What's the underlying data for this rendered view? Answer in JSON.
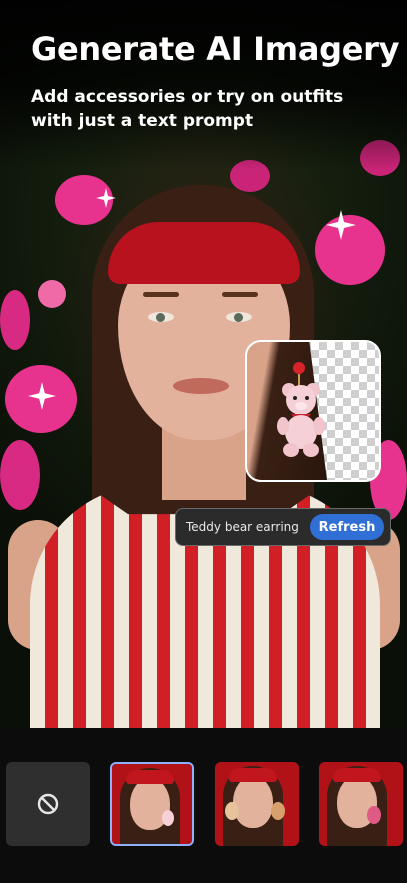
{
  "header": {
    "title": "Generate AI Imagery",
    "subtitle": "Add accessories or try on outfits with just a text prompt"
  },
  "prompt_bar": {
    "text": "Teddy bear earring",
    "button_label": "Refresh"
  },
  "thumbnails": [
    {
      "name": "none-option",
      "icon": "no-symbol-icon",
      "selected": false
    },
    {
      "name": "teddy-bear-earring",
      "selected": true
    },
    {
      "name": "bear-earrings-variant",
      "selected": false
    },
    {
      "name": "bear-earring-pink-variant",
      "selected": false
    }
  ],
  "colors": {
    "accent": "#2f6fd6",
    "selected_border": "#8fb0ff",
    "headband": "#b8121e",
    "flowers": "#e8338e"
  }
}
